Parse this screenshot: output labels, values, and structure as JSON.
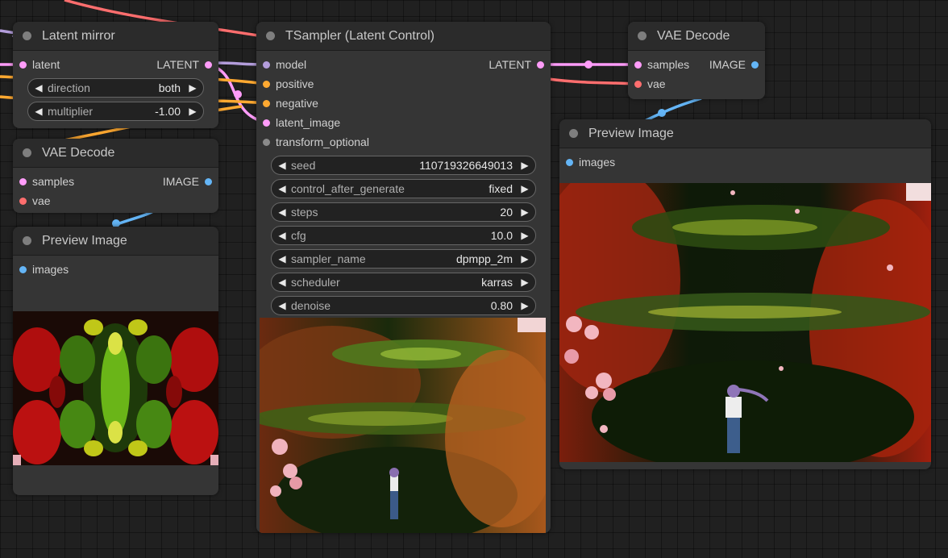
{
  "colors": {
    "latent": "#ff9cf9",
    "model": "#b39ddb",
    "conditioning": "#ffa931",
    "vae": "#ff6e6e",
    "image": "#64b5f6",
    "generic": "#9a9a9a"
  },
  "latent_mirror": {
    "title": "Latent mirror",
    "input": "latent",
    "output": "LATENT",
    "widgets": [
      {
        "label": "direction",
        "value": "both"
      },
      {
        "label": "multiplier",
        "value": "-1.00"
      }
    ]
  },
  "vae_decode_left": {
    "title": "VAE Decode",
    "inputs": [
      "samples",
      "vae"
    ],
    "output": "IMAGE"
  },
  "preview_left": {
    "title": "Preview Image",
    "input": "images"
  },
  "tsampler": {
    "title": "TSampler (Latent Control)",
    "inputs": [
      "model",
      "positive",
      "negative",
      "latent_image",
      "transform_optional"
    ],
    "output": "LATENT",
    "widgets": [
      {
        "label": "seed",
        "value": "110719326649013"
      },
      {
        "label": "control_after_generate",
        "value": "fixed"
      },
      {
        "label": "steps",
        "value": "20"
      },
      {
        "label": "cfg",
        "value": "10.0"
      },
      {
        "label": "sampler_name",
        "value": "dpmpp_2m"
      },
      {
        "label": "scheduler",
        "value": "karras"
      },
      {
        "label": "denoise",
        "value": "0.80"
      }
    ]
  },
  "vae_decode_right": {
    "title": "VAE Decode",
    "inputs": [
      "samples",
      "vae"
    ],
    "output": "IMAGE"
  },
  "preview_right": {
    "title": "Preview Image",
    "input": "images"
  },
  "icons": {
    "left_arrow": "◀",
    "right_arrow": "▶"
  }
}
